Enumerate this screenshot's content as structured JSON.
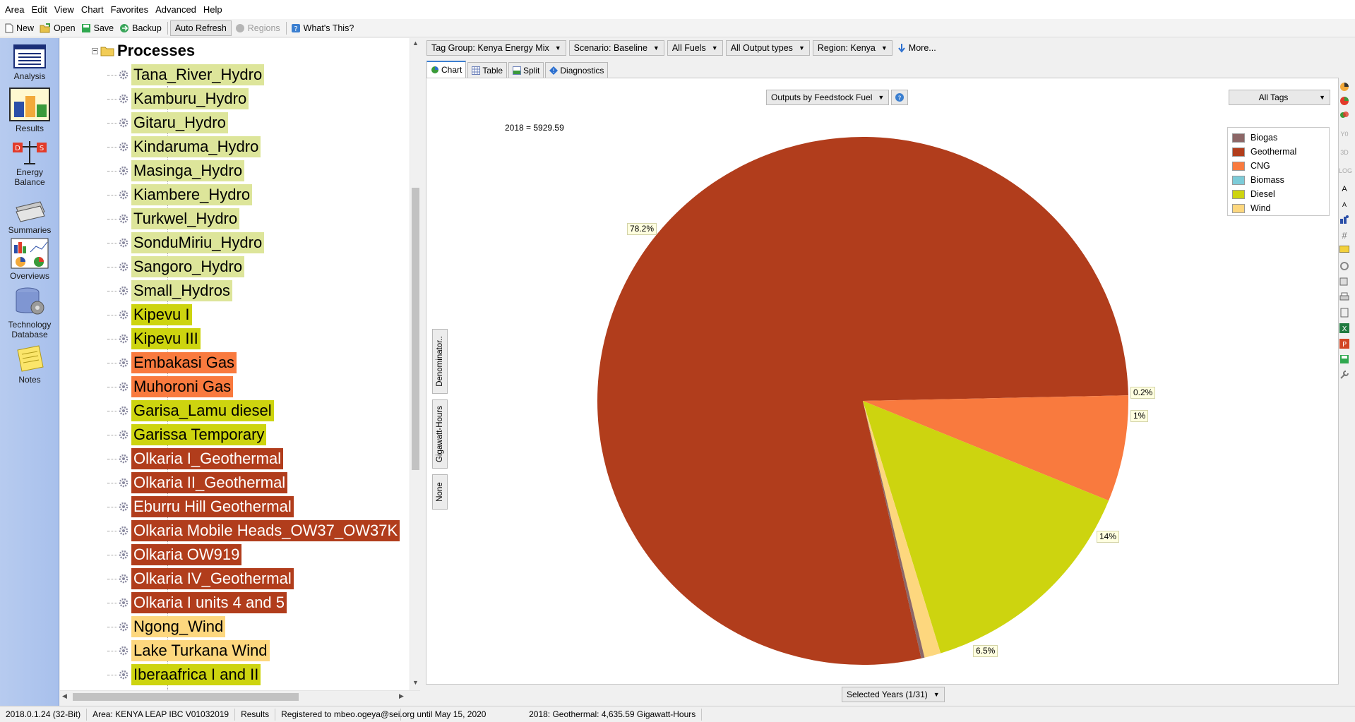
{
  "menu": [
    "Area",
    "Edit",
    "View",
    "Chart",
    "Favorites",
    "Advanced",
    "Help"
  ],
  "toolbar": {
    "new": "New",
    "open": "Open",
    "save": "Save",
    "backup": "Backup",
    "auto_refresh": "Auto Refresh",
    "regions": "Regions",
    "whats_this": "What's This?"
  },
  "nav": {
    "analysis": "Analysis",
    "results": "Results",
    "energy_balance": "Energy Balance",
    "summaries": "Summaries",
    "overviews": "Overviews",
    "technology_database": "Technology Database",
    "notes": "Notes"
  },
  "tree": {
    "header": "Processes",
    "items": [
      {
        "label": "Tana_River_Hydro",
        "bg": "#dde59a",
        "fg": "#000000"
      },
      {
        "label": "Kamburu_Hydro",
        "bg": "#dde59a",
        "fg": "#000000"
      },
      {
        "label": "Gitaru_Hydro",
        "bg": "#dde59a",
        "fg": "#000000"
      },
      {
        "label": "Kindaruma_Hydro",
        "bg": "#dde59a",
        "fg": "#000000"
      },
      {
        "label": "Masinga_Hydro",
        "bg": "#dde59a",
        "fg": "#000000"
      },
      {
        "label": "Kiambere_Hydro",
        "bg": "#dde59a",
        "fg": "#000000"
      },
      {
        "label": "Turkwel_Hydro",
        "bg": "#dde59a",
        "fg": "#000000"
      },
      {
        "label": "SonduMiriu_Hydro",
        "bg": "#dde59a",
        "fg": "#000000"
      },
      {
        "label": "Sangoro_Hydro",
        "bg": "#dde59a",
        "fg": "#000000"
      },
      {
        "label": "Small_Hydros",
        "bg": "#dde59a",
        "fg": "#000000"
      },
      {
        "label": "Kipevu I",
        "bg": "#cdd40f",
        "fg": "#000000"
      },
      {
        "label": "Kipevu III",
        "bg": "#cdd40f",
        "fg": "#000000"
      },
      {
        "label": "Embakasi Gas",
        "bg": "#f97a3e",
        "fg": "#000000"
      },
      {
        "label": "Muhoroni Gas",
        "bg": "#f97a3e",
        "fg": "#000000"
      },
      {
        "label": "Garisa_Lamu diesel",
        "bg": "#cdd40f",
        "fg": "#000000"
      },
      {
        "label": "Garissa Temporary",
        "bg": "#cdd40f",
        "fg": "#000000"
      },
      {
        "label": "Olkaria I_Geothermal",
        "bg": "#b13d1c",
        "fg": "#ffffff"
      },
      {
        "label": "Olkaria II_Geothermal",
        "bg": "#b13d1c",
        "fg": "#ffffff"
      },
      {
        "label": "Eburru Hill Geothermal",
        "bg": "#b13d1c",
        "fg": "#ffffff"
      },
      {
        "label": "Olkaria Mobile Heads_OW37_OW37K",
        "bg": "#b13d1c",
        "fg": "#ffffff"
      },
      {
        "label": "Olkaria OW919",
        "bg": "#b13d1c",
        "fg": "#ffffff"
      },
      {
        "label": "Olkaria IV_Geothermal",
        "bg": "#b13d1c",
        "fg": "#ffffff"
      },
      {
        "label": "Olkaria I units 4 and 5",
        "bg": "#b13d1c",
        "fg": "#ffffff"
      },
      {
        "label": "Ngong_Wind",
        "bg": "#fdd77e",
        "fg": "#000000"
      },
      {
        "label": "Lake Turkana Wind",
        "bg": "#fdd77e",
        "fg": "#000000"
      },
      {
        "label": "Iberaafrica I and II",
        "bg": "#cdd40f",
        "fg": "#000000"
      }
    ]
  },
  "filters": {
    "tag_group": "Tag Group: Kenya Energy Mix",
    "scenario": "Scenario: Baseline",
    "fuels": "All Fuels",
    "output_types": "All Output types",
    "region": "Region: Kenya",
    "more": "More..."
  },
  "tabs": {
    "chart": "Chart",
    "table": "Table",
    "split": "Split",
    "diagnostics": "Diagnostics"
  },
  "chart_controls": {
    "feedstock": "Outputs by Feedstock Fuel",
    "all_tags": "All Tags",
    "selected_years": "Selected Years (1/31)",
    "denominator": "Denominator..",
    "units": "Gigawatt-Hours",
    "none": "None"
  },
  "chart_data": {
    "type": "pie",
    "annotation": "2018 = 5929.59",
    "legend_entries": [
      "Biogas",
      "Geothermal",
      "CNG",
      "Biomass",
      "Diesel",
      "Wind"
    ],
    "legend_colors": [
      "#8c6767",
      "#b13d1c",
      "#f97a3e",
      "#7ccbd8",
      "#cdd40f",
      "#fdd77e"
    ],
    "slices": [
      {
        "name": "Geothermal",
        "percent": 78.2,
        "label": "78.2%",
        "color": "#b13d1c"
      },
      {
        "name": "CNG",
        "percent": 6.5,
        "label": "6.5%",
        "color": "#f97a3e"
      },
      {
        "name": "Diesel",
        "percent": 14.1,
        "label": "14%",
        "color": "#cdd40f"
      },
      {
        "name": "Wind",
        "percent": 1.0,
        "label": "1%",
        "color": "#fdd77e"
      },
      {
        "name": "Biogas",
        "percent": 0.2,
        "label": "0.2%",
        "color": "#8c6767"
      }
    ],
    "legend_placement": "top-right"
  },
  "status": {
    "version": "2018.0.1.24 (32-Bit)",
    "area": "Area: KENYA LEAP IBC V01032019",
    "view": "Results",
    "registered": "Registered to mbeo.ogeya@sei.org until May 15, 2020",
    "hover": "2018: Geothermal: 4,635.59 Gigawatt-Hours"
  }
}
